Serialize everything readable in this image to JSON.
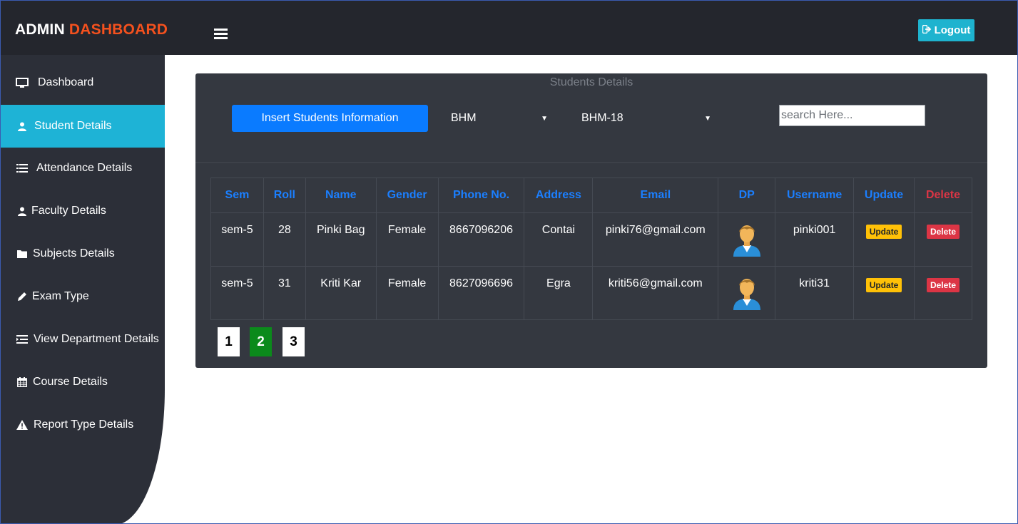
{
  "header": {
    "brand_main": "ADMIN",
    "brand_accent": "DASHBOARD",
    "logout_label": "Logout"
  },
  "sidebar": {
    "items": [
      {
        "label": "Dashboard",
        "icon": "monitor-icon"
      },
      {
        "label": "Student Details",
        "icon": "user-icon",
        "active": true
      },
      {
        "label": "Attendance Details",
        "icon": "list-icon"
      },
      {
        "label": "Faculty Details",
        "icon": "user-icon"
      },
      {
        "label": "Subjects Details",
        "icon": "folder-icon"
      },
      {
        "label": "Exam Type",
        "icon": "pencil-icon"
      },
      {
        "label": "View Department Details",
        "icon": "indent-list-icon"
      },
      {
        "label": "Course Details",
        "icon": "calendar-icon"
      },
      {
        "label": "Report Type Details",
        "icon": "warning-icon"
      }
    ]
  },
  "panel": {
    "title": "Students Details",
    "insert_label": "Insert Students Information",
    "department_select": "BHM",
    "batch_select": "BHM-18",
    "search_placeholder": "search Here..."
  },
  "table": {
    "headers": [
      "Sem",
      "Roll",
      "Name",
      "Gender",
      "Phone No.",
      "Address",
      "Email",
      "DP",
      "Username",
      "Update",
      "Delete"
    ],
    "update_label": "Update",
    "delete_label": "Delete",
    "rows": [
      {
        "sem": "sem-5",
        "roll": "28",
        "name": "Pinki Bag",
        "gender": "Female",
        "phone": "8667096206",
        "address": "Contai",
        "email": "pinki76@gmail.com",
        "username": "pinki001"
      },
      {
        "sem": "sem-5",
        "roll": "31",
        "name": "Kriti Kar",
        "gender": "Female",
        "phone": "8627096696",
        "address": "Egra",
        "email": "kriti56@gmail.com",
        "username": "kriti31"
      }
    ]
  },
  "pagination": {
    "pages": [
      "1",
      "2",
      "3"
    ],
    "current": "2"
  },
  "colors": {
    "topbar": "#24262d",
    "sidebar": "#2c2f38",
    "active_nav": "#1eb3d6",
    "brand_accent": "#f4511e",
    "panel": "#343840",
    "primary_button": "#0a7bff",
    "header_text": "#1b7fff",
    "delete": "#dc3545",
    "update": "#ffc107",
    "current_page": "#0b8a1b"
  }
}
